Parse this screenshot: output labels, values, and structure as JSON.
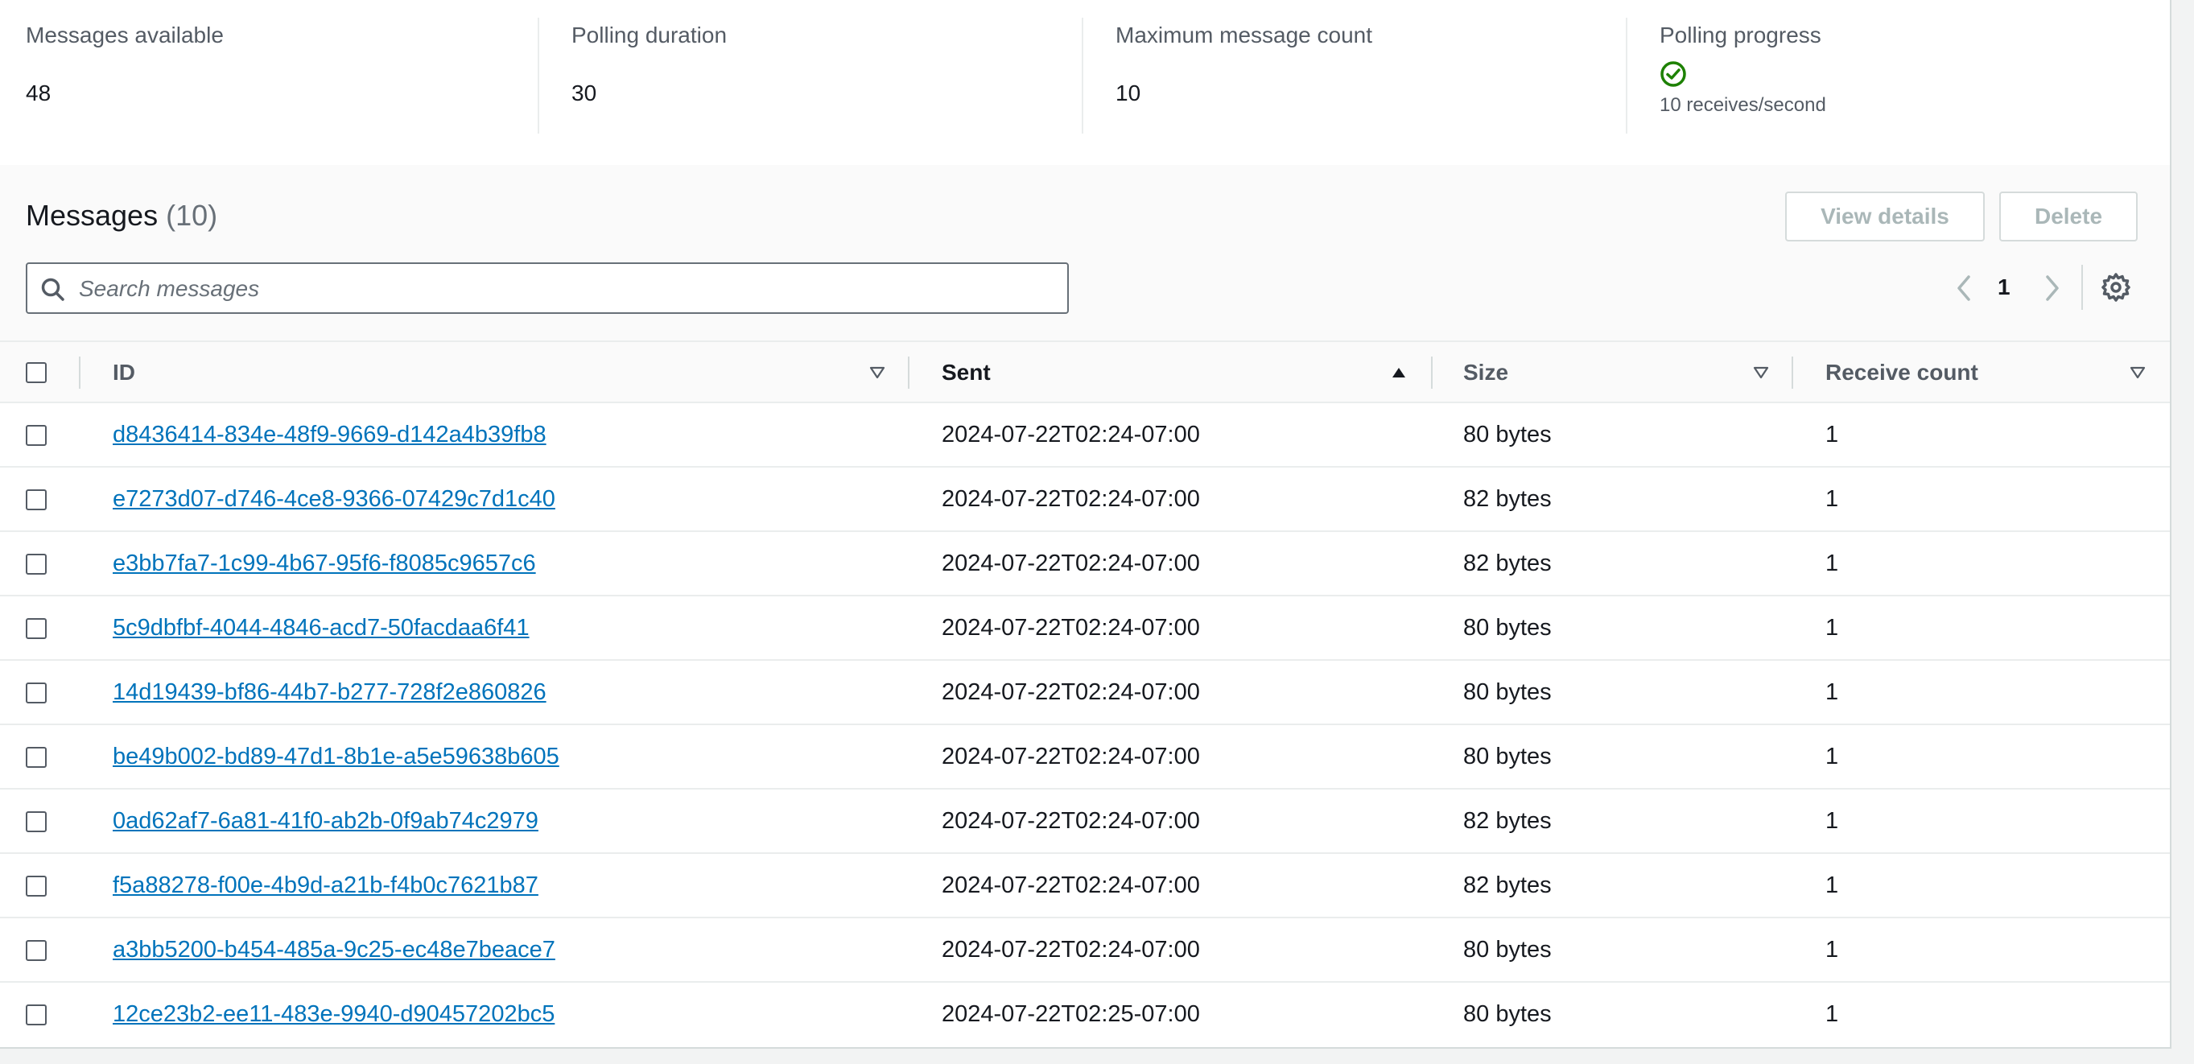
{
  "summary": {
    "messages_available": {
      "label": "Messages available",
      "value": "48"
    },
    "polling_duration": {
      "label": "Polling duration",
      "value": "30"
    },
    "max_message_count": {
      "label": "Maximum message count",
      "value": "10"
    },
    "polling_progress": {
      "label": "Polling progress",
      "status_icon": "check-circle-icon",
      "rate": "10 receives/second",
      "color": "#1d8102"
    }
  },
  "messages": {
    "title": "Messages",
    "count": "(10)",
    "view_details_label": "View details",
    "delete_label": "Delete",
    "search": {
      "placeholder": "Search messages",
      "value": ""
    },
    "pagination": {
      "current_page": "1"
    }
  },
  "table": {
    "columns": [
      {
        "label": "ID",
        "sort": "none"
      },
      {
        "label": "Sent",
        "sort": "ascending"
      },
      {
        "label": "Size",
        "sort": "none"
      },
      {
        "label": "Receive count",
        "sort": "none"
      }
    ],
    "rows": [
      {
        "id": "d8436414-834e-48f9-9669-d142a4b39fb8",
        "sent": "2024-07-22T02:24-07:00",
        "size": "80 bytes",
        "receive_count": "1"
      },
      {
        "id": "e7273d07-d746-4ce8-9366-07429c7d1c40",
        "sent": "2024-07-22T02:24-07:00",
        "size": "82 bytes",
        "receive_count": "1"
      },
      {
        "id": "e3bb7fa7-1c99-4b67-95f6-f8085c9657c6",
        "sent": "2024-07-22T02:24-07:00",
        "size": "82 bytes",
        "receive_count": "1"
      },
      {
        "id": "5c9dbfbf-4044-4846-acd7-50facdaa6f41",
        "sent": "2024-07-22T02:24-07:00",
        "size": "80 bytes",
        "receive_count": "1"
      },
      {
        "id": "14d19439-bf86-44b7-b277-728f2e860826",
        "sent": "2024-07-22T02:24-07:00",
        "size": "80 bytes",
        "receive_count": "1"
      },
      {
        "id": "be49b002-bd89-47d1-8b1e-a5e59638b605",
        "sent": "2024-07-22T02:24-07:00",
        "size": "80 bytes",
        "receive_count": "1"
      },
      {
        "id": "0ad62af7-6a81-41f0-ab2b-0f9ab74c2979",
        "sent": "2024-07-22T02:24-07:00",
        "size": "82 bytes",
        "receive_count": "1"
      },
      {
        "id": "f5a88278-f00e-4b9d-a21b-f4b0c7621b87",
        "sent": "2024-07-22T02:24-07:00",
        "size": "82 bytes",
        "receive_count": "1"
      },
      {
        "id": "a3bb5200-b454-485a-9c25-ec48e7beace7",
        "sent": "2024-07-22T02:24-07:00",
        "size": "80 bytes",
        "receive_count": "1"
      },
      {
        "id": "12ce23b2-ee11-483e-9940-d90457202bc5",
        "sent": "2024-07-22T02:25-07:00",
        "size": "80 bytes",
        "receive_count": "1"
      }
    ]
  }
}
